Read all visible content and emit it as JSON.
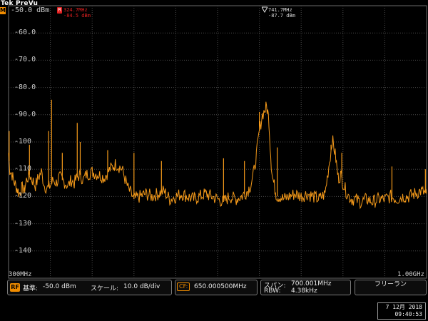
{
  "header": {
    "brand": "Tek PreVu",
    "brand_mark": "M",
    "reference_level": "-50.0 dBm"
  },
  "markers": {
    "m1": {
      "icon": "R",
      "freq": "324.7MHz",
      "level": "-84.5 dBm",
      "color": "#e02020"
    },
    "m2": {
      "freq": "741.7MHz",
      "level": "-87.7 dBm"
    }
  },
  "chart_data": {
    "type": "line",
    "title": "",
    "xlabel": "",
    "ylabel": "",
    "xlim": [
      300,
      1000
    ],
    "x_unit": "MHz",
    "ylim": [
      -150,
      -50
    ],
    "y_ticks": [
      "-60.0",
      "-70.0",
      "-80.0",
      "-90.0",
      "-100",
      "-110",
      "-120",
      "-130",
      "-140"
    ],
    "x_start_label": "300MHz",
    "x_stop_label": "1.00GHz",
    "grid": true,
    "series": [
      {
        "color": "#f59a1a",
        "x": [
          300,
          302,
          304,
          306,
          308,
          310,
          312,
          314,
          316,
          318,
          320,
          322,
          324,
          326,
          328,
          330,
          335,
          340,
          345,
          350,
          355,
          360,
          365,
          370,
          375,
          380,
          385,
          390,
          395,
          400,
          405,
          410,
          415,
          420,
          425,
          430,
          440,
          450,
          460,
          470,
          480,
          490,
          500,
          510,
          520,
          530,
          540,
          550,
          560,
          570,
          580,
          590,
          600,
          610,
          620,
          630,
          640,
          650,
          660,
          670,
          680,
          690,
          700,
          705,
          710,
          715,
          720,
          725,
          730,
          732,
          734,
          736,
          738,
          740,
          742,
          744,
          746,
          748,
          750,
          755,
          760,
          770,
          780,
          790,
          800,
          810,
          820,
          830,
          840,
          842,
          845,
          848,
          850,
          852,
          854,
          856,
          858,
          860,
          865,
          870,
          875,
          880,
          890,
          900,
          910,
          920,
          930,
          940,
          950,
          960,
          970,
          980,
          990,
          1000
        ],
        "y": [
          -104,
          -110,
          -111,
          -112,
          -114,
          -115,
          -116,
          -117,
          -118,
          -119,
          -118,
          -117,
          -117,
          -118,
          -116,
          -114,
          -112,
          -114,
          -116,
          -113,
          -111,
          -116,
          -117,
          -116,
          -114,
          -115,
          -113,
          -114,
          -115,
          -116,
          -114,
          -115,
          -113,
          -112,
          -114,
          -112,
          -111,
          -112,
          -113,
          -110,
          -108,
          -110,
          -117,
          -121,
          -120,
          -119,
          -120,
          -119,
          -118,
          -121,
          -120,
          -119,
          -120,
          -121,
          -120,
          -119,
          -120,
          -121,
          -122,
          -120,
          -121,
          -120,
          -118,
          -116,
          -112,
          -105,
          -96,
          -90,
          -88,
          -87,
          -89,
          -92,
          -101,
          -108,
          -113,
          -115,
          -117,
          -119,
          -120,
          -120,
          -121,
          -120,
          -119,
          -120,
          -119,
          -120,
          -121,
          -119,
          -103,
          -99,
          -102,
          -106,
          -110,
          -113,
          -113,
          -112,
          -113,
          -115,
          -118,
          -120,
          -121,
          -121,
          -122,
          -121,
          -122,
          -121,
          -121,
          -120,
          -121,
          -120,
          -120,
          -119,
          -118,
          -119
        ]
      }
    ],
    "spikes": [
      {
        "x": 301,
        "y": -96
      },
      {
        "x": 335,
        "y": -101
      },
      {
        "x": 367,
        "y": -96
      },
      {
        "x": 372,
        "y": -84.5
      },
      {
        "x": 390,
        "y": -104
      },
      {
        "x": 415,
        "y": -93
      },
      {
        "x": 420,
        "y": -100
      },
      {
        "x": 466,
        "y": -103
      },
      {
        "x": 510,
        "y": -104
      },
      {
        "x": 556,
        "y": -107
      },
      {
        "x": 660,
        "y": -106
      },
      {
        "x": 695,
        "y": -107
      },
      {
        "x": 720,
        "y": -89
      },
      {
        "x": 750,
        "y": -102
      },
      {
        "x": 840,
        "y": -101
      },
      {
        "x": 858,
        "y": -104
      },
      {
        "x": 942,
        "y": -109
      },
      {
        "x": 998,
        "y": -110
      }
    ]
  },
  "status_bar": {
    "rf_badge": "RF",
    "ref_label": "基準:",
    "ref_value": "-50.0 dBm",
    "scale_label": "スケール:",
    "scale_value": "10.0 dB/div",
    "cf_badge": "CF:",
    "cf_value": "650.000500MHz",
    "span_label": "スパン:",
    "span_value": "700.001MHz",
    "rbw_label": "RBW:",
    "rbw_value": "4.38kHz",
    "mode": "フリーラン"
  },
  "clock": {
    "date": "7 12月 2018",
    "time": "09:40:53"
  }
}
